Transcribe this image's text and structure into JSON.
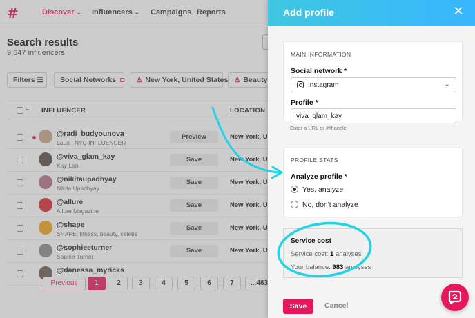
{
  "nav": {
    "logo": "#",
    "items": [
      {
        "label": "Discover",
        "has_menu": true,
        "active": true
      },
      {
        "label": "Influencers",
        "has_menu": true,
        "active": false
      },
      {
        "label": "Campaigns",
        "has_menu": false,
        "active": false
      },
      {
        "label": "Reports",
        "has_menu": false,
        "active": false
      }
    ]
  },
  "results": {
    "title": "Search results",
    "count": "9,647 influencers"
  },
  "filters": {
    "button": "Filters",
    "chips": [
      "Social Networks",
      "New York, United States",
      "Beauty &"
    ]
  },
  "table": {
    "headers": {
      "influencer": "INFLUENCER",
      "location": "LOCATION"
    },
    "rows": [
      {
        "handle": "@radi_budyounova",
        "sub": "LaLa | NYC INFLUENCER",
        "action": "Preview",
        "location": "New York, U...",
        "avatar_color": "#c9a48a",
        "marked": true
      },
      {
        "handle": "@viva_glam_kay",
        "sub": "Kay-Lani",
        "action": "Save",
        "location": "New York, U...",
        "avatar_color": "#5a4a44",
        "marked": false
      },
      {
        "handle": "@nikitaupadhyay",
        "sub": "Nikita Upadhyay",
        "action": "Save",
        "location": "New York, U...",
        "avatar_color": "#b0708a",
        "marked": false
      },
      {
        "handle": "@allure",
        "sub": "Allure Magazine",
        "action": "Save",
        "location": "New York, U...",
        "avatar_color": "#d6282e",
        "marked": false
      },
      {
        "handle": "@shape",
        "sub": "SHAPE: fitness, beauty, celebs",
        "action": "Save",
        "location": "New York, U...",
        "avatar_color": "#f0a21a",
        "marked": false
      },
      {
        "handle": "@sophieeturner",
        "sub": "Sophie Turner",
        "action": "Save",
        "location": "New York, U...",
        "avatar_color": "#8a8a8a",
        "marked": false
      },
      {
        "handle": "@danessa_myricks",
        "sub": "",
        "action": "",
        "location": "",
        "avatar_color": "#6b5a52",
        "marked": false
      }
    ]
  },
  "pagination": {
    "previous": "Previous",
    "pages": [
      "1",
      "2",
      "3",
      "4",
      "5",
      "6",
      "7",
      "...483"
    ],
    "current": "1"
  },
  "panel": {
    "title": "Add profile",
    "close_icon": "close-icon",
    "main_info": {
      "section_label": "MAIN INFORMATION",
      "network_label": "Social network *",
      "network_value": "Instagram",
      "profile_label": "Profile *",
      "profile_value": "viva_glam_kay",
      "profile_hint": "Enter a URL or @handle"
    },
    "stats": {
      "section_label": "PROFILE STATS",
      "analyze_label": "Analyze profile *",
      "options": [
        {
          "label": "Yes, analyze",
          "selected": true
        },
        {
          "label": "No, don't analyze",
          "selected": false
        }
      ]
    },
    "cost": {
      "title": "Service cost",
      "cost_prefix": "Service cost: ",
      "cost_value": "1",
      "cost_suffix": " analyses",
      "balance_prefix": "Your balance: ",
      "balance_value": "983",
      "balance_suffix": " analyses"
    },
    "save_label": "Save",
    "cancel_label": "Cancel"
  },
  "colors": {
    "brand": "#e8175d",
    "header_gradient_start": "#3ec7e0",
    "header_gradient_end": "#38b6ff",
    "annotation": "#22d3e8"
  }
}
